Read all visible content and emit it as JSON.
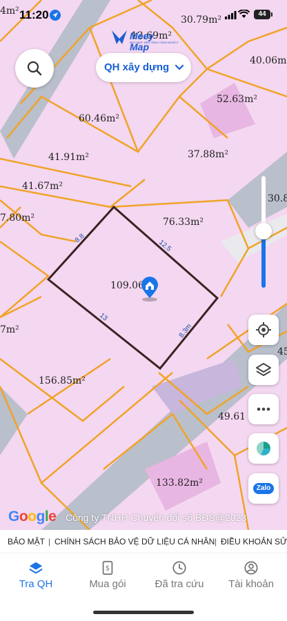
{
  "status_bar": {
    "time": "11:20",
    "battery": "44"
  },
  "logo": {
    "text": "Meey Map",
    "subtitle": "MEY MAP: NỀN TẢNG CÔNG NGHỆ BẤT ĐỘNG SẢN"
  },
  "map": {
    "layer_selector": "QH xây dựng",
    "parcel_areas": [
      "4m²",
      "12.69m²",
      "30.79m²",
      "40.06m²",
      "52.63m²",
      "60.46m²",
      "41.91m²",
      "37.88m²",
      "41.67m²",
      "30.8",
      "76.33m²",
      "7.80m²",
      "109.06",
      "7m²",
      "45",
      "156.85m²",
      "49.61",
      "133.82m²"
    ],
    "edge_lengths": [
      "8.8",
      "12.5",
      "13",
      "8.3m"
    ],
    "attribution": "Công ty TNHH Chuyển đổi số BĐS@2023",
    "google": "Google"
  },
  "legal_links": [
    "BẢO MẬT",
    "CHÍNH SÁCH BẢO VỆ DỮ LIỆU CÁ NHÂN",
    "ĐIỀU KHOẢN SỬ"
  ],
  "fab": {
    "zalo": "Zalo"
  },
  "tabs": [
    {
      "label": "Tra QH",
      "icon": "layers-icon",
      "active": true
    },
    {
      "label": "Mua gói",
      "icon": "price-tag-icon",
      "active": false
    },
    {
      "label": "Đã tra cứu",
      "icon": "clock-icon",
      "active": false
    },
    {
      "label": "Tài khoản",
      "icon": "account-icon",
      "active": false
    }
  ],
  "colors": {
    "accent": "#1b74e8",
    "parcel_fill": "#f4d7f0",
    "parcel_line": "#f0a326",
    "road": "#b9bfcb",
    "selected_outline": "#3a2222"
  }
}
